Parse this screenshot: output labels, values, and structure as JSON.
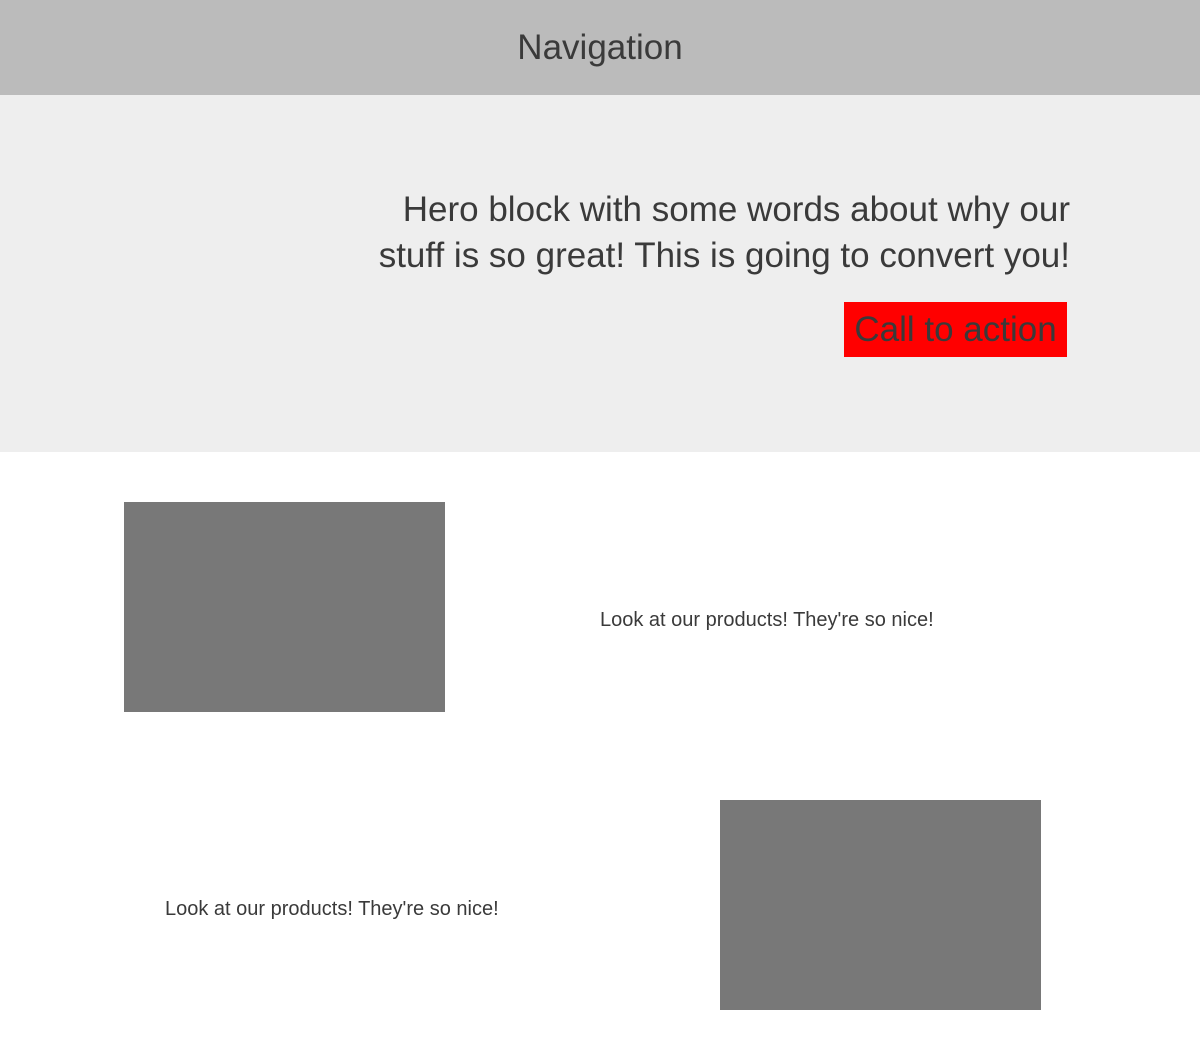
{
  "navigation": {
    "title": "Navigation"
  },
  "hero": {
    "text": "Hero block with some words about why our stuff is so great! This is going to convert you!",
    "cta_label": "Call to action"
  },
  "products": [
    {
      "text": "Look at our products! They're so nice!"
    },
    {
      "text": "Look at our products! They're so nice!"
    }
  ],
  "colors": {
    "nav_background": "#bbbbbb",
    "hero_background": "#eeeeee",
    "cta_background": "#ff0000",
    "image_placeholder": "#787878",
    "text": "#3a3a3a"
  }
}
